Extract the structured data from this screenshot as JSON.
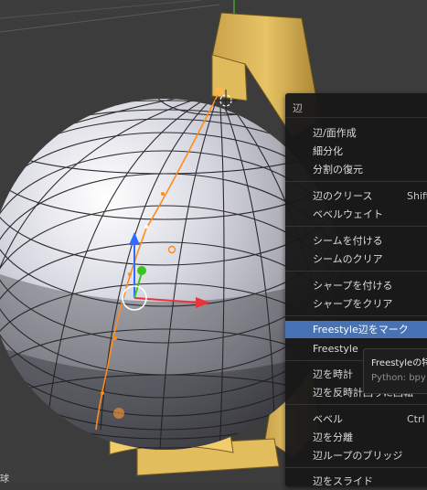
{
  "menu": {
    "title": "辺",
    "items": [
      {
        "label": "辺/面作成",
        "shortcut": ""
      },
      {
        "label": "細分化",
        "shortcut": ""
      },
      {
        "label": "分割の復元",
        "shortcut": ""
      },
      {
        "label": "辺のクリース",
        "shortcut": "Shift"
      },
      {
        "label": "ベベルウェイト",
        "shortcut": ""
      },
      {
        "label": "シームを付ける",
        "shortcut": ""
      },
      {
        "label": "シームのクリア",
        "shortcut": ""
      },
      {
        "label": "シャープを付ける",
        "shortcut": ""
      },
      {
        "label": "シャープをクリア",
        "shortcut": ""
      },
      {
        "label": "Freestyle辺をマーク",
        "shortcut": ""
      },
      {
        "label": "Freestyle",
        "shortcut": ""
      },
      {
        "label": "辺を時計",
        "shortcut": ""
      },
      {
        "label": "辺を反時計回りに回転",
        "shortcut": ""
      },
      {
        "label": "ベベル",
        "shortcut": "Ctrl"
      },
      {
        "label": "辺を分離",
        "shortcut": ""
      },
      {
        "label": "辺ループのブリッジ",
        "shortcut": ""
      },
      {
        "label": "辺をスライド",
        "shortcut": ""
      }
    ]
  },
  "tooltip": {
    "title": "Freestyleの特",
    "python": "Python: bpy"
  },
  "viewport": {
    "corner_label": "球"
  },
  "colors": {
    "menu_bg": "#181818",
    "highlight": "#4772b3",
    "globe_stand": "#d9b455",
    "edge_orange": "#ff8c1a",
    "gizmo_x": "#e8343b",
    "gizmo_y": "#39c41f",
    "gizmo_z": "#2f6bff"
  }
}
